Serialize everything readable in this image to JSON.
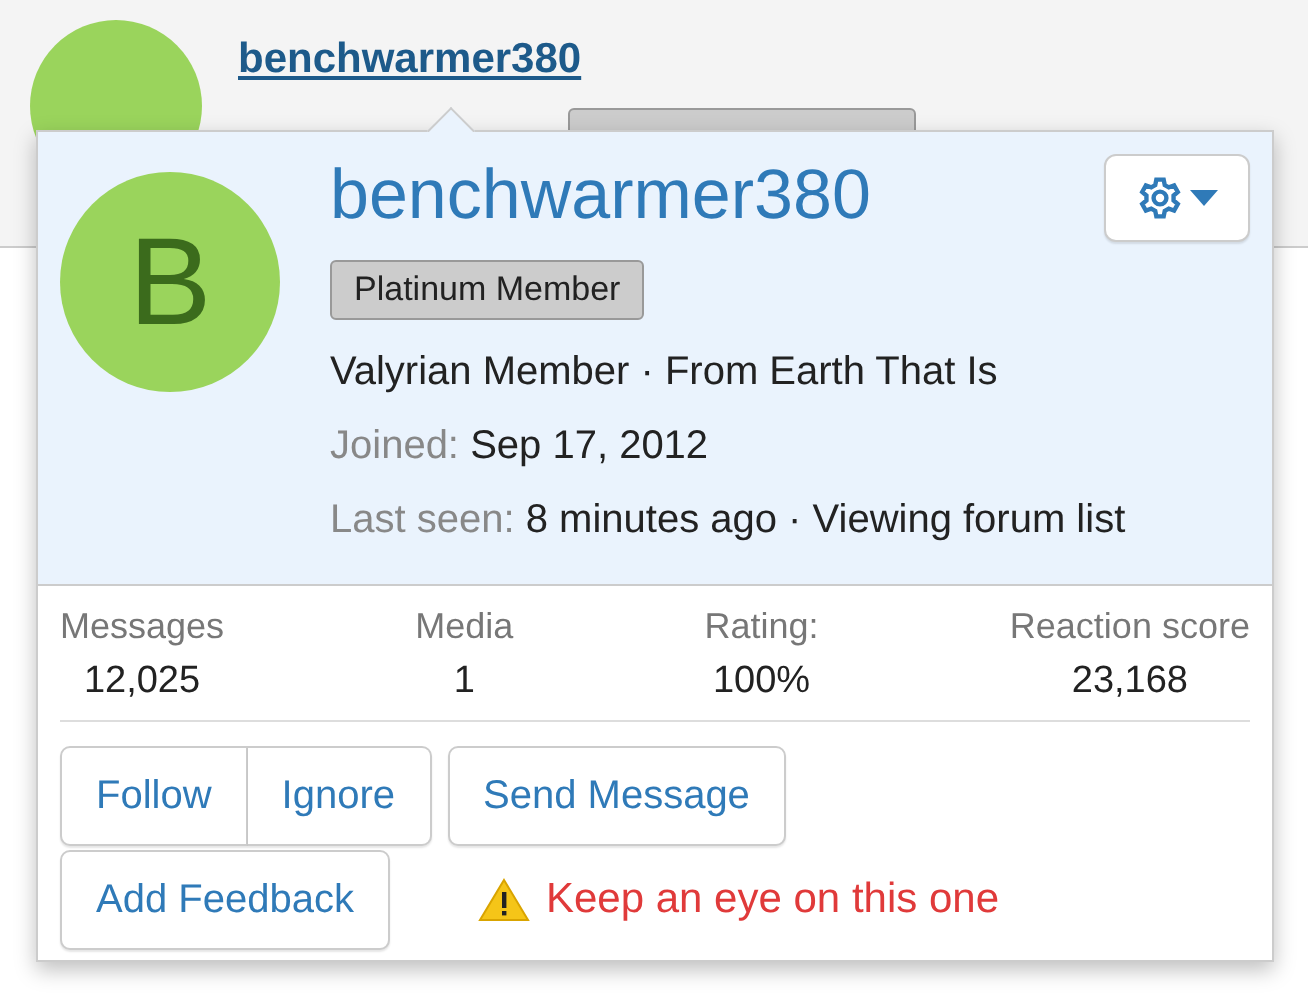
{
  "page": {
    "username": "benchwarmer380"
  },
  "member_card": {
    "avatar_letter": "B",
    "username": "benchwarmer380",
    "badge": "Platinum Member",
    "user_title": "Valyrian Member · From Earth That Is",
    "details": [
      {
        "label": "Joined:",
        "value": "Sep 17, 2012"
      },
      {
        "label": "Last seen:",
        "value": "8 minutes ago · Viewing forum list"
      }
    ],
    "stats": [
      {
        "label": "Messages",
        "value": "12,025"
      },
      {
        "label": "Media",
        "value": "1"
      },
      {
        "label": "Rating:",
        "value": "100%"
      },
      {
        "label": "Reaction score",
        "value": "23,168"
      }
    ],
    "action_rows": [
      [
        {
          "kind": "button-group",
          "labels": [
            "Follow",
            "Ignore"
          ]
        },
        {
          "kind": "button",
          "label": "Send Message"
        }
      ],
      [
        {
          "kind": "button",
          "label": "Add Feedback"
        },
        {
          "kind": "warning",
          "text": "Keep an eye on this one"
        }
      ]
    ]
  }
}
